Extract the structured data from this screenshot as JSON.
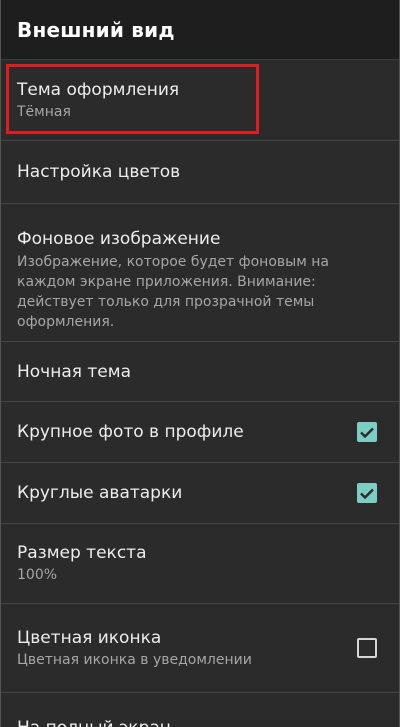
{
  "toolbar": {
    "title": "Внешний вид"
  },
  "settings": {
    "theme": {
      "title": "Тема оформления",
      "value": "Тёмная"
    },
    "colors": {
      "title": "Настройка цветов"
    },
    "background": {
      "title": "Фоновое изображение",
      "desc_lines": [
        "Изображение, которое будет фоновым на",
        "каждом экране приложения. Внимание:",
        "действует только для прозрачной темы",
        "оформления."
      ]
    },
    "night": {
      "title": "Ночная тема"
    },
    "big_photo": {
      "title": "Крупное фото в профиле",
      "checked": true
    },
    "round_avatars": {
      "title": "Круглые аватарки",
      "checked": true
    },
    "text_size": {
      "title": "Размер текста",
      "value": "100%"
    },
    "color_icon": {
      "title": "Цветная иконка",
      "subtitle": "Цветная иконка в уведомлении",
      "checked": false
    },
    "fullscreen": {
      "title": "На полный экран"
    }
  },
  "colors": {
    "highlight": "#e11b22",
    "checkbox_checked": "#7ccdc3",
    "background": "#2b2b2b",
    "toolbar": "#1e1e1e"
  }
}
